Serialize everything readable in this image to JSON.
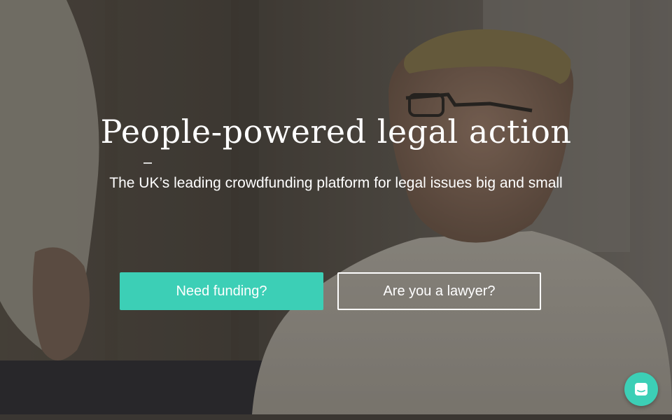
{
  "hero": {
    "title": "People-powered legal action",
    "subtitle": "The UK’s leading crowdfunding platform for legal issues big and small"
  },
  "actions": {
    "primary_label": "Need funding?",
    "secondary_label": "Are you a lawyer?"
  },
  "chat": {
    "icon": "chat-icon"
  },
  "colors": {
    "accent": "#3ccfb6",
    "text": "#ffffff"
  }
}
